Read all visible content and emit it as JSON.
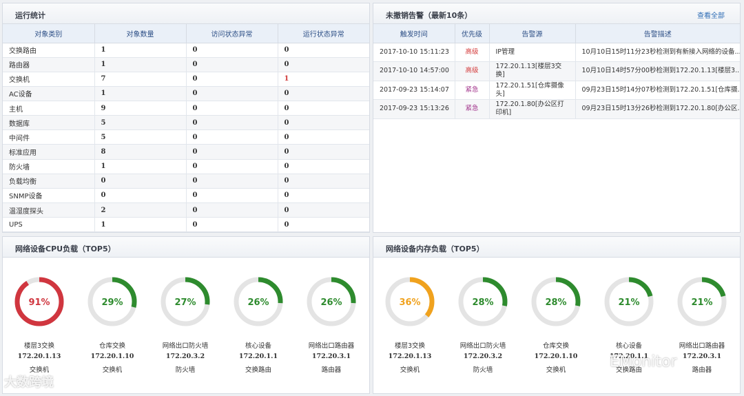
{
  "stats": {
    "title": "运行统计",
    "columns": [
      "对象类别",
      "对象数量",
      "访问状态异常",
      "运行状态异常"
    ],
    "rows": [
      {
        "category": "交换路由",
        "count": "1",
        "access_abnormal": "0",
        "run_abnormal": "0"
      },
      {
        "category": "路由器",
        "count": "1",
        "access_abnormal": "0",
        "run_abnormal": "0"
      },
      {
        "category": "交换机",
        "count": "7",
        "access_abnormal": "0",
        "run_abnormal": "1"
      },
      {
        "category": "AC设备",
        "count": "1",
        "access_abnormal": "0",
        "run_abnormal": "0"
      },
      {
        "category": "主机",
        "count": "9",
        "access_abnormal": "0",
        "run_abnormal": "0"
      },
      {
        "category": "数据库",
        "count": "5",
        "access_abnormal": "0",
        "run_abnormal": "0"
      },
      {
        "category": "中间件",
        "count": "5",
        "access_abnormal": "0",
        "run_abnormal": "0"
      },
      {
        "category": "标准应用",
        "count": "8",
        "access_abnormal": "0",
        "run_abnormal": "0"
      },
      {
        "category": "防火墙",
        "count": "1",
        "access_abnormal": "0",
        "run_abnormal": "0"
      },
      {
        "category": "负载均衡",
        "count": "0",
        "access_abnormal": "0",
        "run_abnormal": "0"
      },
      {
        "category": "SNMP设备",
        "count": "0",
        "access_abnormal": "0",
        "run_abnormal": "0"
      },
      {
        "category": "温湿度探头",
        "count": "2",
        "access_abnormal": "0",
        "run_abnormal": "0"
      },
      {
        "category": "UPS",
        "count": "1",
        "access_abnormal": "0",
        "run_abnormal": "0"
      }
    ]
  },
  "alarms": {
    "title": "未撤销告警（最新10条）",
    "view_all": "查看全部",
    "columns": [
      "触发时间",
      "优先级",
      "告警源",
      "告警描述"
    ],
    "rows": [
      {
        "time": "2017-10-10 15:11:23",
        "priority": "高级",
        "priority_level": "high",
        "source": "IP管理",
        "desc": "10月10日15时11分23秒检测到有新接入网络的设备..."
      },
      {
        "time": "2017-10-10 14:57:00",
        "priority": "高级",
        "priority_level": "high",
        "source": "172.20.1.13[楼层3交换]",
        "desc": "10月10日14时57分00秒检测到172.20.1.13[楼层3..."
      },
      {
        "time": "2017-09-23 15:14:07",
        "priority": "紧急",
        "priority_level": "urgent",
        "source": "172.20.1.51[仓库摄像头]",
        "desc": "09月23日15时14分07秒检测到172.20.1.51[仓库摄..."
      },
      {
        "time": "2017-09-23 15:13:26",
        "priority": "紧急",
        "priority_level": "urgent",
        "source": "172.20.1.80[办公区打印机]",
        "desc": "09月23日15时13分26秒检测到172.20.1.80[办公区..."
      }
    ]
  },
  "cpu": {
    "title": "网络设备CPU负载（TOP5）",
    "items": [
      {
        "percent": 91,
        "label": "91%",
        "color": "#d0363f",
        "name": "楼层3交换",
        "ip": "172.20.1.13",
        "type": "交换机"
      },
      {
        "percent": 29,
        "label": "29%",
        "color": "#2e8b2e",
        "name": "仓库交换",
        "ip": "172.20.1.10",
        "type": "交换机"
      },
      {
        "percent": 27,
        "label": "27%",
        "color": "#2e8b2e",
        "name": "网络出口防火墙",
        "ip": "172.20.3.2",
        "type": "防火墙"
      },
      {
        "percent": 26,
        "label": "26%",
        "color": "#2e8b2e",
        "name": "核心设备",
        "ip": "172.20.1.1",
        "type": "交换路由"
      },
      {
        "percent": 26,
        "label": "26%",
        "color": "#2e8b2e",
        "name": "网络出口路由器",
        "ip": "172.20.3.1",
        "type": "路由器"
      }
    ]
  },
  "memory": {
    "title": "网络设备内存负载（TOP5）",
    "items": [
      {
        "percent": 36,
        "label": "36%",
        "color": "#f0a21e",
        "name": "楼层3交换",
        "ip": "172.20.1.13",
        "type": "交换机"
      },
      {
        "percent": 28,
        "label": "28%",
        "color": "#2e8b2e",
        "name": "网络出口防火墙",
        "ip": "172.20.3.2",
        "type": "防火墙"
      },
      {
        "percent": 28,
        "label": "28%",
        "color": "#2e8b2e",
        "name": "仓库交换",
        "ip": "172.20.1.10",
        "type": "交换机"
      },
      {
        "percent": 21,
        "label": "21%",
        "color": "#2e8b2e",
        "name": "核心设备",
        "ip": "172.20.1.1",
        "type": "交换路由"
      },
      {
        "percent": 21,
        "label": "21%",
        "color": "#2e8b2e",
        "name": "网络出口路由器",
        "ip": "172.20.3.1",
        "type": "路由器"
      }
    ]
  },
  "theme": {
    "track_color": "#e4e4e4",
    "red": "#d23c3c"
  },
  "watermarks": {
    "left": "大数跨境",
    "right": "EMonitor"
  }
}
